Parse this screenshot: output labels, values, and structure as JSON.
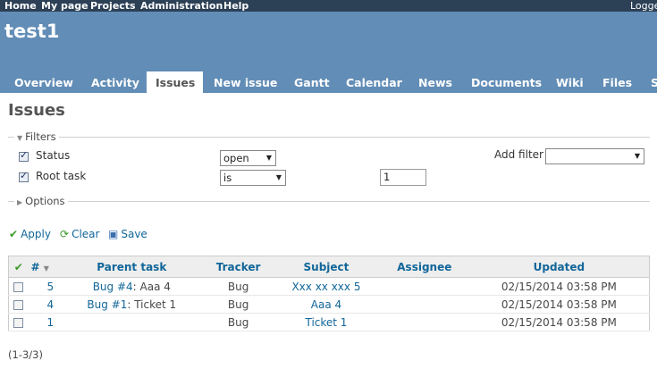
{
  "top_menu": {
    "home": "Home",
    "my_page": "My page",
    "projects": "Projects",
    "administration": "Administration",
    "help": "Help",
    "logged": "Logge"
  },
  "header": {
    "project_title": "test1"
  },
  "tabs": [
    "Overview",
    "Activity",
    "Issues",
    "New issue",
    "Gantt",
    "Calendar",
    "News",
    "Documents",
    "Wiki",
    "Files",
    "S"
  ],
  "page_title": "Issues",
  "filters": {
    "legend": "Filters",
    "status_label": "Status",
    "status_value": "open",
    "root_task_label": "Root task",
    "root_task_op": "is",
    "root_task_value": "1",
    "add_filter_label": "Add filter",
    "add_filter_value": ""
  },
  "options_legend": "Options",
  "actions": {
    "apply": "Apply",
    "clear": "Clear",
    "save": "Save"
  },
  "table": {
    "headers": {
      "number": "#",
      "parent_task": "Parent task",
      "tracker": "Tracker",
      "subject": "Subject",
      "assignee": "Assignee",
      "updated": "Updated"
    },
    "rows": [
      {
        "id": "5",
        "parent_link": "Bug #4",
        "parent_rest": ": Aaa 4",
        "tracker": "Bug",
        "subject": "Xxx xx xxx 5",
        "assignee": "",
        "updated": "02/15/2014 03:58 PM"
      },
      {
        "id": "4",
        "parent_link": "Bug #1",
        "parent_rest": ": Ticket 1",
        "tracker": "Bug",
        "subject": "Aaa 4",
        "assignee": "",
        "updated": "02/15/2014 03:58 PM"
      },
      {
        "id": "1",
        "parent_link": "",
        "parent_rest": "",
        "tracker": "Bug",
        "subject": "Ticket 1",
        "assignee": "",
        "updated": "02/15/2014 03:58 PM"
      }
    ]
  },
  "pagination_count": "(1-3/3)",
  "icons": {
    "apply": "checkmark-icon",
    "clear": "reload-icon",
    "save": "floppy-disk-icon"
  },
  "colors": {
    "top_bar": "#2C4056",
    "header": "#628DB6",
    "link": "#116699"
  }
}
